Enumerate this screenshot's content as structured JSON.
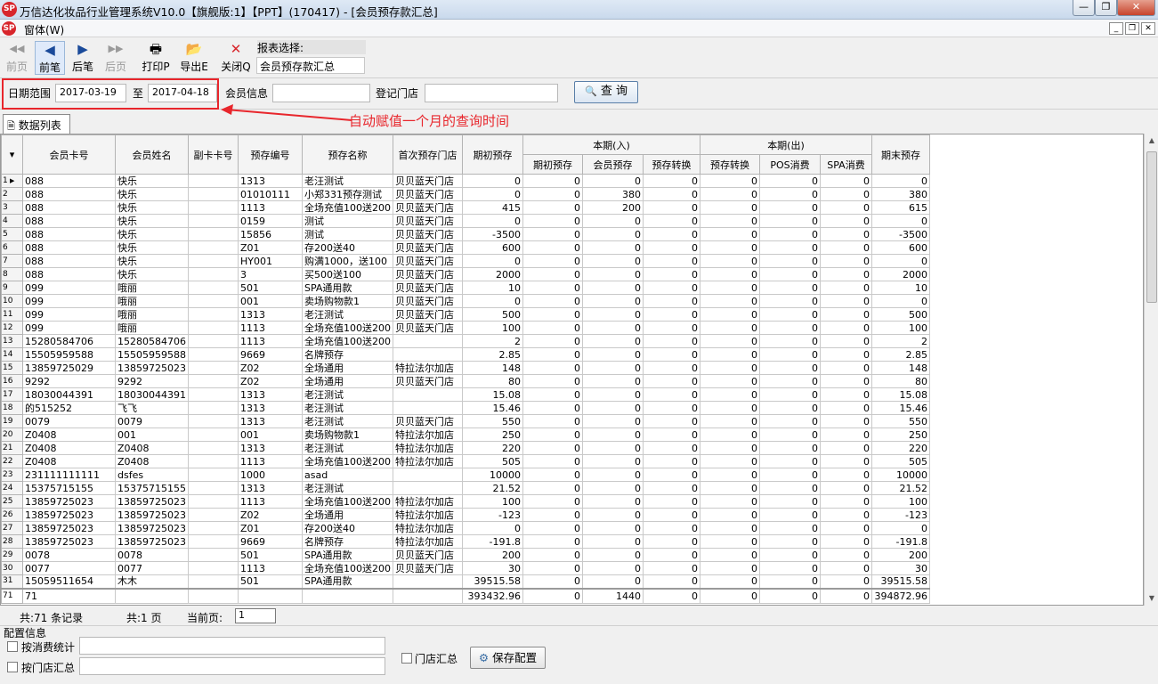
{
  "window": {
    "title": "万信达化妆品行业管理系统V10.0【旗舰版:1】【PPT】(170417) - [会员预存款汇总]"
  },
  "menu": {
    "item": "窗体(W)",
    "logo": "SP"
  },
  "toolbar": {
    "buttons": [
      {
        "label": "前页",
        "icon": "◀◀"
      },
      {
        "label": "前笔",
        "icon": "◀"
      },
      {
        "label": "后笔",
        "icon": "▶"
      },
      {
        "label": "后页",
        "icon": "▶▶"
      },
      {
        "label": "打印P",
        "icon": "🖶"
      },
      {
        "label": "导出E",
        "icon": "📂"
      },
      {
        "label": "关闭Q",
        "icon": "✕"
      }
    ],
    "report_label": "报表选择:",
    "report_value": "会员预存款汇总"
  },
  "filters": {
    "date_label": "日期范围",
    "date_from": "2017-03-19",
    "to_label": "至",
    "date_to": "2017-04-18",
    "member_label": "会员信息",
    "member_value": "",
    "store_label": "登记门店",
    "store_value": "",
    "query_label": "查 询",
    "annotation": "自动赋值一个月的查询时间"
  },
  "tab": {
    "label": "数据列表"
  },
  "grid": {
    "headers": {
      "card": "会员卡号",
      "name": "会员姓名",
      "subcard": "副卡卡号",
      "prepay_no": "预存编号",
      "prepay_name": "预存名称",
      "first_store": "首次预存门店",
      "opening": "期初预存",
      "in_group": "本期(入)",
      "in_opening": "期初预存",
      "in_member": "会员预存",
      "in_transfer": "预存转换",
      "out_group": "本期(出)",
      "out_transfer": "预存转换",
      "out_pos": "POS消费",
      "out_spa": "SPA消费",
      "closing": "期末预存"
    },
    "rows": [
      [
        "1",
        "088",
        "快乐",
        "",
        "1313",
        "老汪测试",
        "贝贝蓝天门店",
        "0",
        "0",
        "0",
        "0",
        "0",
        "0",
        "0",
        "0"
      ],
      [
        "2",
        "088",
        "快乐",
        "",
        "01010111",
        "小郑331预存测试",
        "贝贝蓝天门店",
        "0",
        "0",
        "380",
        "0",
        "0",
        "0",
        "0",
        "380"
      ],
      [
        "3",
        "088",
        "快乐",
        "",
        "1113",
        "全场充值100送200",
        "贝贝蓝天门店",
        "415",
        "0",
        "200",
        "0",
        "0",
        "0",
        "0",
        "615"
      ],
      [
        "4",
        "088",
        "快乐",
        "",
        "0159",
        "测试",
        "贝贝蓝天门店",
        "0",
        "0",
        "0",
        "0",
        "0",
        "0",
        "0",
        "0"
      ],
      [
        "5",
        "088",
        "快乐",
        "",
        "15856",
        "测试",
        "贝贝蓝天门店",
        "-3500",
        "0",
        "0",
        "0",
        "0",
        "0",
        "0",
        "-3500"
      ],
      [
        "6",
        "088",
        "快乐",
        "",
        "Z01",
        "存200送40",
        "贝贝蓝天门店",
        "600",
        "0",
        "0",
        "0",
        "0",
        "0",
        "0",
        "600"
      ],
      [
        "7",
        "088",
        "快乐",
        "",
        "HY001",
        "购满1000，送100",
        "贝贝蓝天门店",
        "0",
        "0",
        "0",
        "0",
        "0",
        "0",
        "0",
        "0"
      ],
      [
        "8",
        "088",
        "快乐",
        "",
        "3",
        "买500送100",
        "贝贝蓝天门店",
        "2000",
        "0",
        "0",
        "0",
        "0",
        "0",
        "0",
        "2000"
      ],
      [
        "9",
        "099",
        "哦丽",
        "",
        "501",
        "SPA通用款",
        "贝贝蓝天门店",
        "10",
        "0",
        "0",
        "0",
        "0",
        "0",
        "0",
        "10"
      ],
      [
        "10",
        "099",
        "哦丽",
        "",
        "001",
        "卖场购物款1",
        "贝贝蓝天门店",
        "0",
        "0",
        "0",
        "0",
        "0",
        "0",
        "0",
        "0"
      ],
      [
        "11",
        "099",
        "哦丽",
        "",
        "1313",
        "老汪测试",
        "贝贝蓝天门店",
        "500",
        "0",
        "0",
        "0",
        "0",
        "0",
        "0",
        "500"
      ],
      [
        "12",
        "099",
        "哦丽",
        "",
        "1113",
        "全场充值100送200",
        "贝贝蓝天门店",
        "100",
        "0",
        "0",
        "0",
        "0",
        "0",
        "0",
        "100"
      ],
      [
        "13",
        "15280584706",
        "15280584706",
        "",
        "1113",
        "全场充值100送200",
        "",
        "2",
        "0",
        "0",
        "0",
        "0",
        "0",
        "0",
        "2"
      ],
      [
        "14",
        "15505959588",
        "15505959588",
        "",
        "9669",
        "名牌预存",
        "",
        "2.85",
        "0",
        "0",
        "0",
        "0",
        "0",
        "0",
        "2.85"
      ],
      [
        "15",
        "13859725029",
        "13859725023",
        "",
        "Z02",
        "全场通用",
        "特拉法尔加店",
        "148",
        "0",
        "0",
        "0",
        "0",
        "0",
        "0",
        "148"
      ],
      [
        "16",
        "9292",
        "9292",
        "",
        "Z02",
        "全场通用",
        "贝贝蓝天门店",
        "80",
        "0",
        "0",
        "0",
        "0",
        "0",
        "0",
        "80"
      ],
      [
        "17",
        "18030044391",
        "18030044391",
        "",
        "1313",
        "老汪测试",
        "",
        "15.08",
        "0",
        "0",
        "0",
        "0",
        "0",
        "0",
        "15.08"
      ],
      [
        "18",
        "的515252",
        "飞飞",
        "",
        "1313",
        "老汪测试",
        "",
        "15.46",
        "0",
        "0",
        "0",
        "0",
        "0",
        "0",
        "15.46"
      ],
      [
        "19",
        "0079",
        "0079",
        "",
        "1313",
        "老汪测试",
        "贝贝蓝天门店",
        "550",
        "0",
        "0",
        "0",
        "0",
        "0",
        "0",
        "550"
      ],
      [
        "20",
        "Z0408",
        "001",
        "",
        "001",
        "卖场购物款1",
        "特拉法尔加店",
        "250",
        "0",
        "0",
        "0",
        "0",
        "0",
        "0",
        "250"
      ],
      [
        "21",
        "Z0408",
        "Z0408",
        "",
        "1313",
        "老汪测试",
        "特拉法尔加店",
        "220",
        "0",
        "0",
        "0",
        "0",
        "0",
        "0",
        "220"
      ],
      [
        "22",
        "Z0408",
        "Z0408",
        "",
        "1113",
        "全场充值100送200",
        "特拉法尔加店",
        "505",
        "0",
        "0",
        "0",
        "0",
        "0",
        "0",
        "505"
      ],
      [
        "23",
        "231111111111",
        "dsfes",
        "",
        "1000",
        "asad",
        "",
        "10000",
        "0",
        "0",
        "0",
        "0",
        "0",
        "0",
        "10000"
      ],
      [
        "24",
        "15375715155",
        "15375715155",
        "",
        "1313",
        "老汪测试",
        "",
        "21.52",
        "0",
        "0",
        "0",
        "0",
        "0",
        "0",
        "21.52"
      ],
      [
        "25",
        "13859725023",
        "13859725023",
        "",
        "1113",
        "全场充值100送200",
        "特拉法尔加店",
        "100",
        "0",
        "0",
        "0",
        "0",
        "0",
        "0",
        "100"
      ],
      [
        "26",
        "13859725023",
        "13859725023",
        "",
        "Z02",
        "全场通用",
        "特拉法尔加店",
        "-123",
        "0",
        "0",
        "0",
        "0",
        "0",
        "0",
        "-123"
      ],
      [
        "27",
        "13859725023",
        "13859725023",
        "",
        "Z01",
        "存200送40",
        "特拉法尔加店",
        "0",
        "0",
        "0",
        "0",
        "0",
        "0",
        "0",
        "0"
      ],
      [
        "28",
        "13859725023",
        "13859725023",
        "",
        "9669",
        "名牌预存",
        "特拉法尔加店",
        "-191.8",
        "0",
        "0",
        "0",
        "0",
        "0",
        "0",
        "-191.8"
      ],
      [
        "29",
        "0078",
        "0078",
        "",
        "501",
        "SPA通用款",
        "贝贝蓝天门店",
        "200",
        "0",
        "0",
        "0",
        "0",
        "0",
        "0",
        "200"
      ],
      [
        "30",
        "0077",
        "0077",
        "",
        "1113",
        "全场充值100送200",
        "贝贝蓝天门店",
        "30",
        "0",
        "0",
        "0",
        "0",
        "0",
        "0",
        "30"
      ],
      [
        "31",
        "15059511654",
        "木木",
        "",
        "501",
        "SPA通用款",
        "",
        "39515.58",
        "0",
        "0",
        "0",
        "0",
        "0",
        "0",
        "39515.58"
      ]
    ],
    "total": [
      "71",
      "71",
      "",
      "",
      "",
      "",
      "",
      "393432.96",
      "0",
      "1440",
      "0",
      "0",
      "0",
      "0",
      "394872.96"
    ]
  },
  "status": {
    "records": "共:71 条记录",
    "pages": "共:1 页",
    "current_label": "当前页:",
    "current_page": "1"
  },
  "config": {
    "title": "配置信息",
    "by_consumption": "按消费统计",
    "by_store": "按门店汇总",
    "store_summary": "门店汇总",
    "save_label": "保存配置"
  }
}
